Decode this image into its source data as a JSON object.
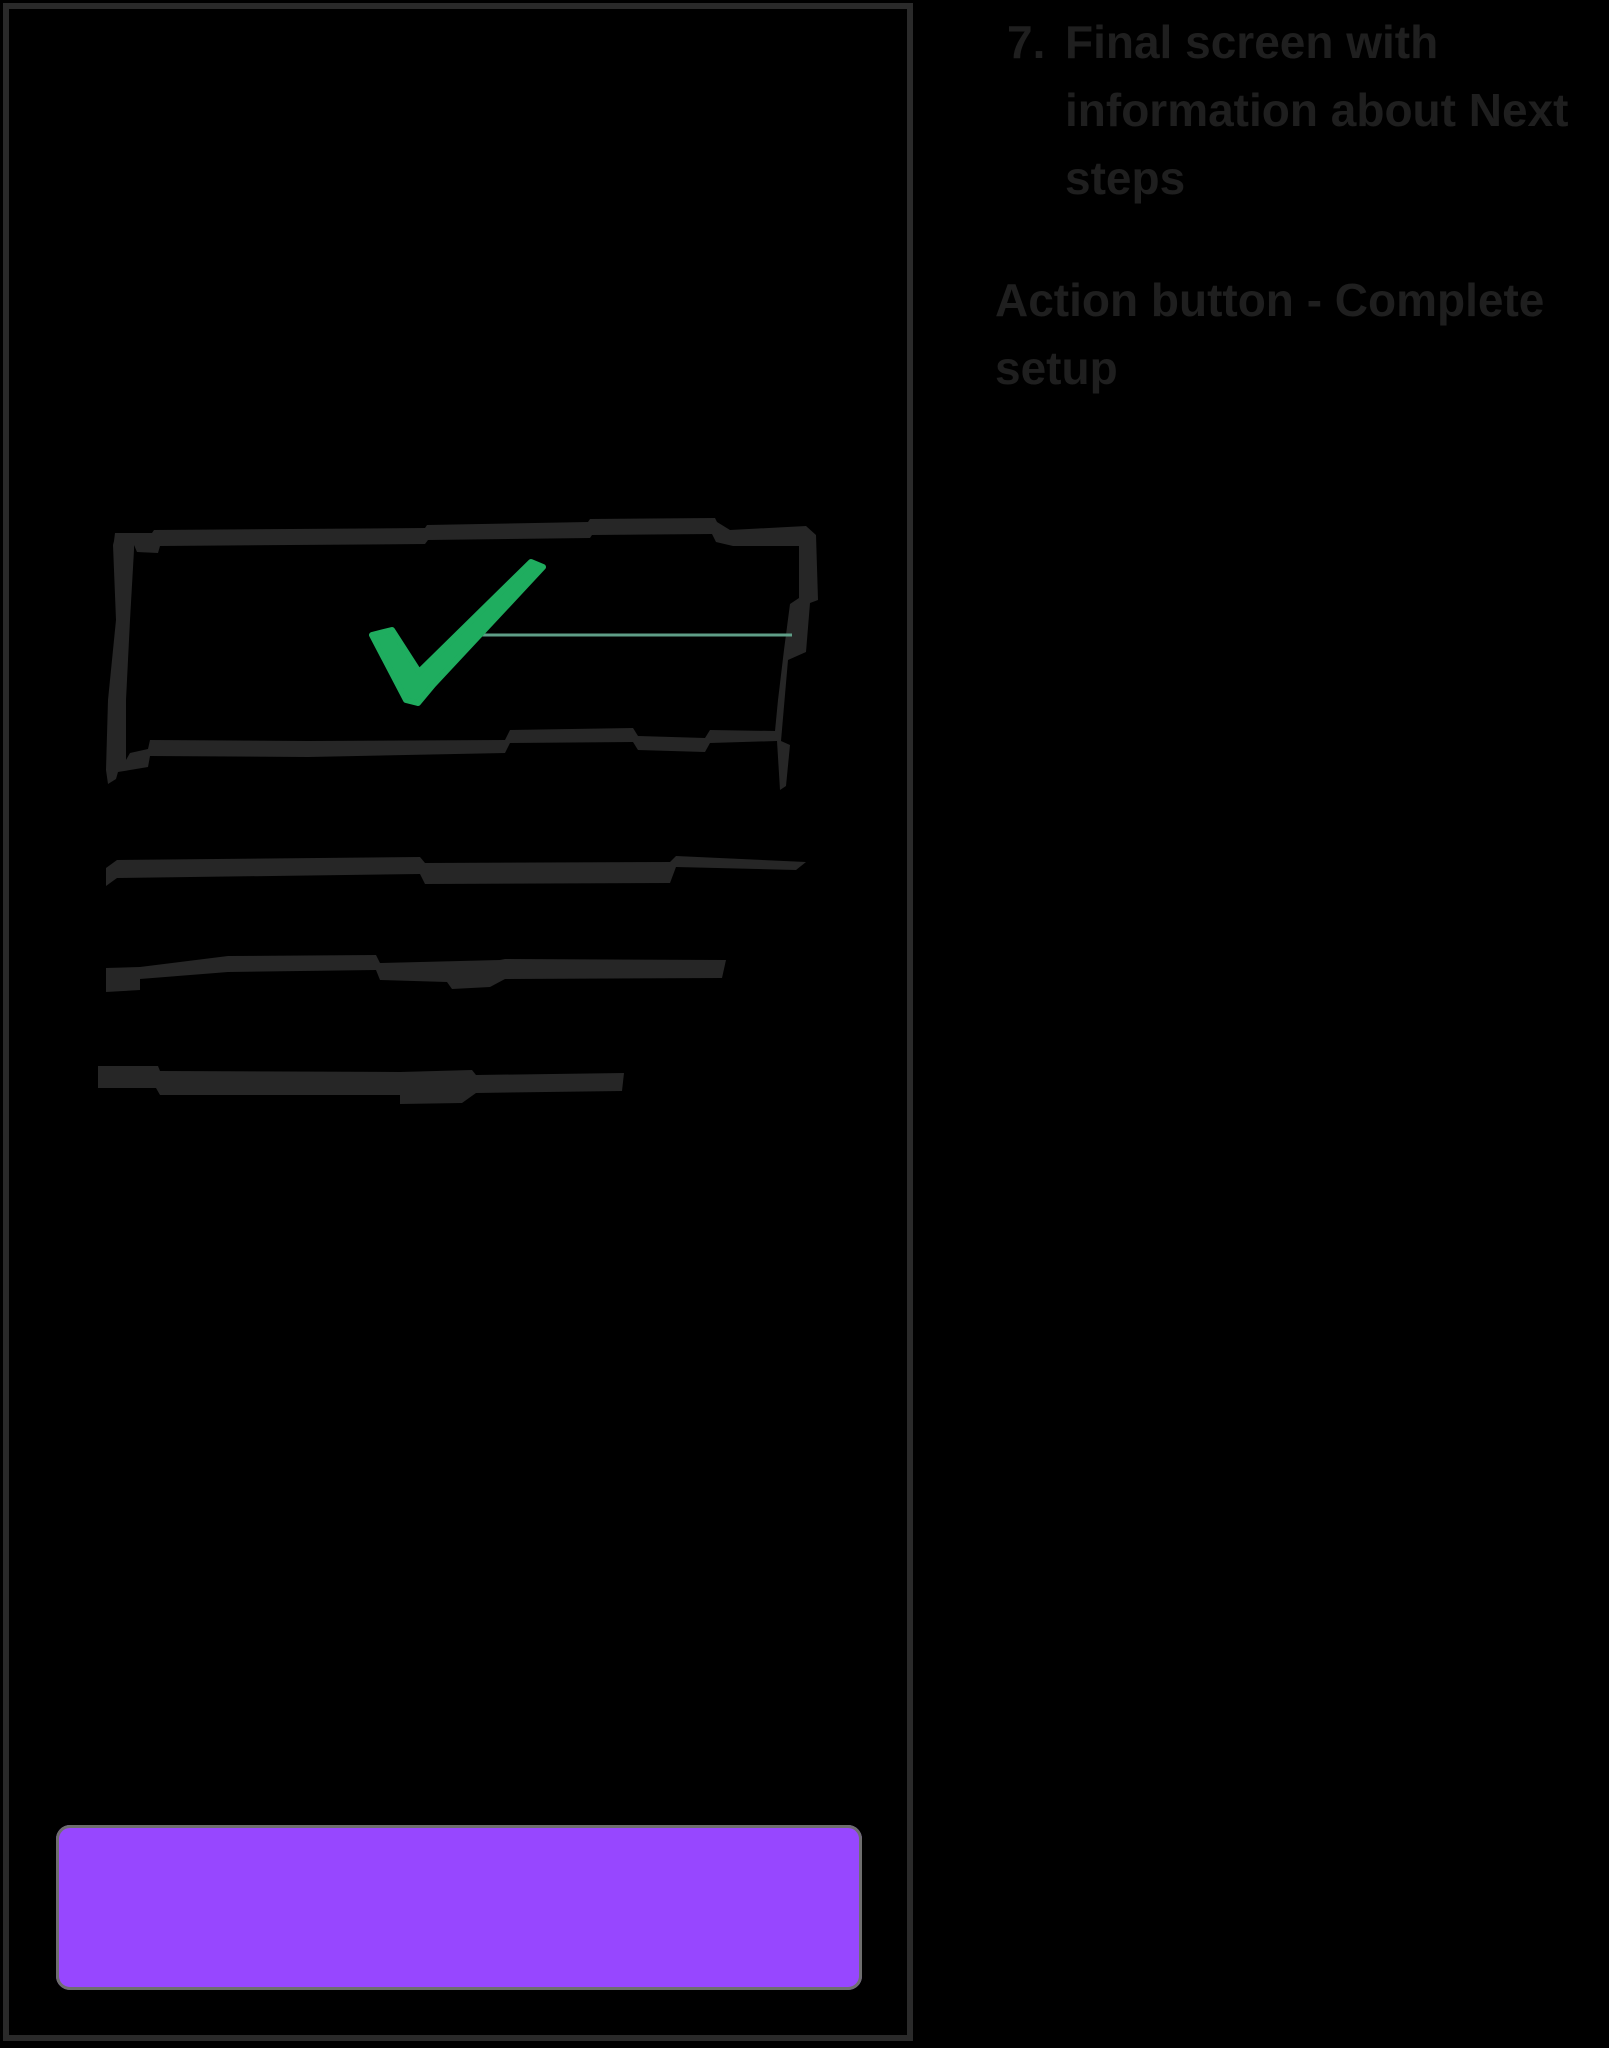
{
  "wireframe": {
    "screen": "phone-wireframe",
    "cta_button": {
      "label": "",
      "color": "#9747ff"
    },
    "check_color": "#1fad5f",
    "sketch_stroke_color": "#2a2a2a"
  },
  "notes": {
    "step_number": "7.",
    "step_title": "Final screen with information about Next steps",
    "action_note": "Action button - Complete setup"
  }
}
